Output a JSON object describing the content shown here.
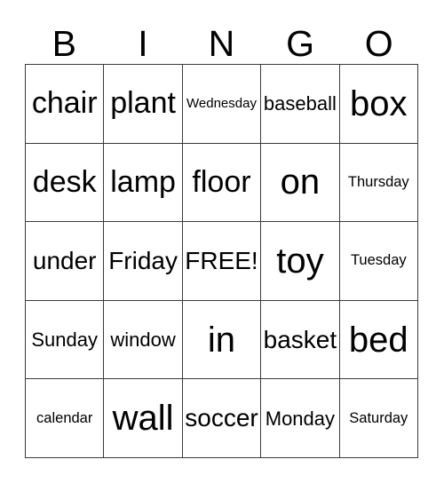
{
  "card": {
    "headers": [
      "B",
      "I",
      "N",
      "G",
      "O"
    ],
    "free_space_label": "FREE!",
    "colors": {
      "background": "#ffffff",
      "text": "#000000",
      "border": "#3b3b3b"
    },
    "rows": [
      [
        {
          "label": "chair",
          "size": "lg"
        },
        {
          "label": "plant",
          "size": "lg"
        },
        {
          "label": "Wednesday",
          "size": "xxs"
        },
        {
          "label": "baseball",
          "size": "sm"
        },
        {
          "label": "box",
          "size": "xl"
        }
      ],
      [
        {
          "label": "desk",
          "size": "lg"
        },
        {
          "label": "lamp",
          "size": "lg"
        },
        {
          "label": "floor",
          "size": "lg"
        },
        {
          "label": "on",
          "size": "xl"
        },
        {
          "label": "Thursday",
          "size": "xs"
        }
      ],
      [
        {
          "label": "under",
          "size": "md"
        },
        {
          "label": "Friday",
          "size": "md"
        },
        {
          "label": "FREE!",
          "size": "md"
        },
        {
          "label": "toy",
          "size": "xl"
        },
        {
          "label": "Tuesday",
          "size": "xs"
        }
      ],
      [
        {
          "label": "Sunday",
          "size": "sm"
        },
        {
          "label": "window",
          "size": "sm"
        },
        {
          "label": "in",
          "size": "xl"
        },
        {
          "label": "basket",
          "size": "md"
        },
        {
          "label": "bed",
          "size": "xl"
        }
      ],
      [
        {
          "label": "calendar",
          "size": "xs"
        },
        {
          "label": "wall",
          "size": "xl"
        },
        {
          "label": "soccer",
          "size": "md"
        },
        {
          "label": "Monday",
          "size": "sm"
        },
        {
          "label": "Saturday",
          "size": "xs"
        }
      ]
    ]
  }
}
